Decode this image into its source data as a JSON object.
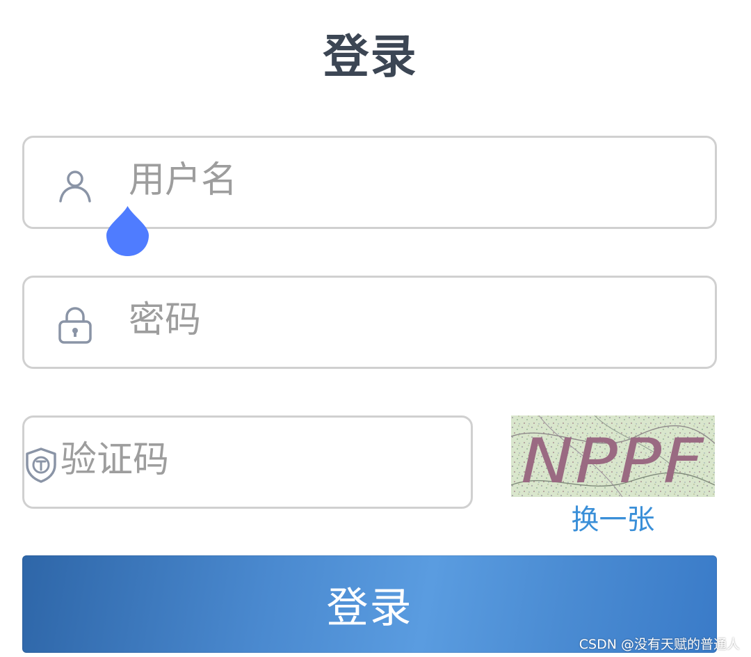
{
  "page": {
    "title": "登录"
  },
  "form": {
    "username": {
      "placeholder": "用户名",
      "value": "",
      "icon": "user-icon"
    },
    "password": {
      "placeholder": "密码",
      "value": "",
      "icon": "lock-icon"
    },
    "captcha": {
      "placeholder": "验证码",
      "value": "",
      "icon": "shield-icon",
      "image_text": "NPPF",
      "refresh_label": "换一张"
    },
    "submit_label": "登录"
  },
  "watermark": "CSDN @没有天赋的普通人",
  "colors": {
    "title": "#3c4654",
    "border": "#d0d0d0",
    "placeholder": "#9d9d9d",
    "link": "#3a8fd8",
    "button": "#4a89cf",
    "cursor_drop": "#4f7cff"
  }
}
